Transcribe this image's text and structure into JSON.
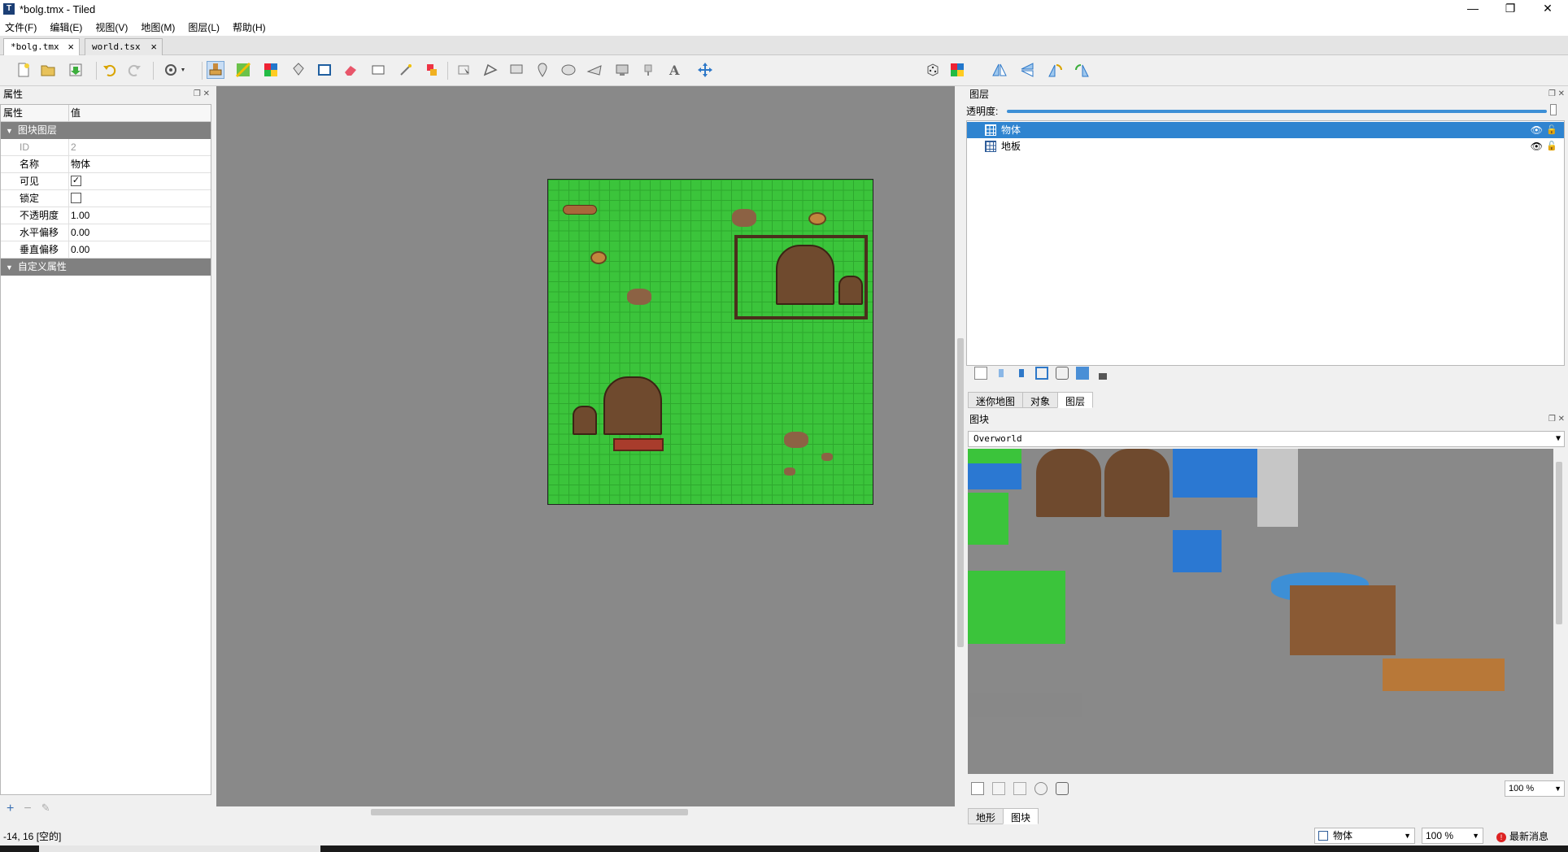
{
  "window": {
    "title": "*bolg.tmx - Tiled",
    "app_icon": "T",
    "controls": {
      "minimize": "—",
      "restore": "❐",
      "close": "✕"
    }
  },
  "menu": [
    "文件(F)",
    "编辑(E)",
    "视图(V)",
    "地图(M)",
    "图层(L)",
    "帮助(H)"
  ],
  "doc_tabs": [
    {
      "label": "*bolg.tmx",
      "active": true
    },
    {
      "label": "world.tsx",
      "active": false
    }
  ],
  "toolbar": {
    "icons": [
      "new-file",
      "open-file",
      "save",
      "undo",
      "redo",
      "commands",
      "stamp-brush",
      "terrain-brush",
      "wang-brush",
      "bucket-fill",
      "shape-fill",
      "eraser",
      "rect-select",
      "magic-wand",
      "select-same-tile",
      "insert-rectangle",
      "edit-polygons",
      "insert-point",
      "insert-ellipse",
      "insert-polygon",
      "insert-tile",
      "insert-template",
      "insert-text",
      "move-objects",
      "random-mode",
      "wang-fill-mode",
      "flip-horizontal",
      "flip-vertical",
      "rotate-left",
      "rotate-right"
    ]
  },
  "properties": {
    "title": "属性",
    "col_name": "属性",
    "col_value": "值",
    "group1": "图块图层",
    "rows": [
      {
        "key": "ID",
        "value": "2"
      },
      {
        "key": "名称",
        "value": "物体"
      },
      {
        "key": "可见",
        "value": "✓"
      },
      {
        "key": "锁定",
        "value": ""
      },
      {
        "key": "不透明度",
        "value": "1.00"
      },
      {
        "key": "水平偏移",
        "value": "0.00"
      },
      {
        "key": "垂直偏移",
        "value": "0.00"
      }
    ],
    "group2": "自定义属性",
    "footer": [
      "+",
      "−",
      "✎"
    ]
  },
  "layers": {
    "title": "图层",
    "opacity_label": "透明度:",
    "opacity": 1.0,
    "items": [
      {
        "name": "物体",
        "selected": true
      },
      {
        "name": "地板",
        "selected": false
      }
    ],
    "visible_icon": "👁",
    "lock_icon": "🔓",
    "tabs": [
      "迷你地图",
      "对象",
      "图层"
    ],
    "active_tab": "图层"
  },
  "tilesets": {
    "title": "图块",
    "current": "Overworld",
    "zoom": "100 %",
    "tabs": [
      "地形",
      "图块"
    ],
    "active_tab": "图块"
  },
  "status": {
    "coords": "-14, 16 [空的]",
    "layer_select": "物体",
    "zoom": "100 %",
    "news": "最新消息",
    "news_icon": "!"
  },
  "colors": {
    "grass": "#3bc43b",
    "canvas_bg": "#898989",
    "selection": "#2f84d0",
    "accent": "#3d8fd6"
  }
}
